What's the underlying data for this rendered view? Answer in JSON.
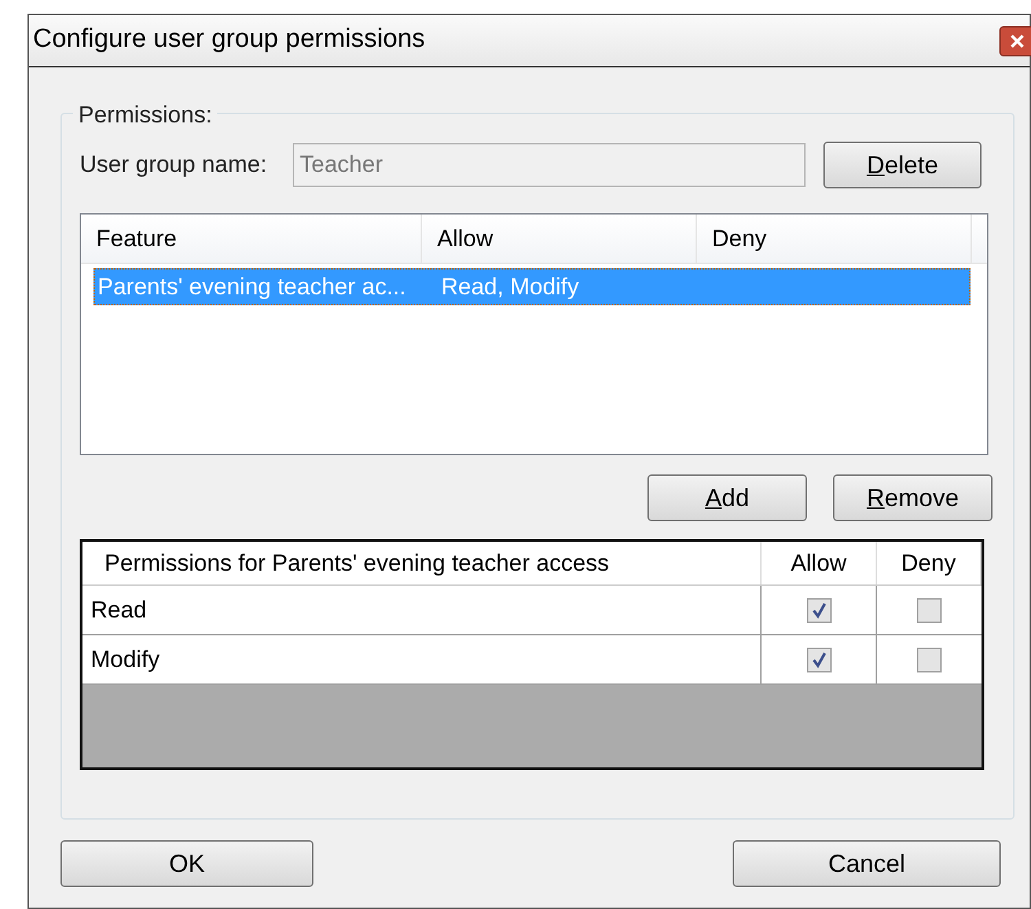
{
  "window": {
    "title": "Configure user group permissions"
  },
  "group": {
    "legend": "Permissions:",
    "name_label": "User group name:",
    "name_value": "Teacher",
    "name_disabled": true,
    "delete_button": {
      "label": "Delete",
      "underline_first": true
    }
  },
  "features": {
    "columns": [
      "Feature",
      "Allow",
      "Deny"
    ],
    "rows": [
      {
        "cells": [
          "Parents' evening teacher ac...",
          "Read, Modify",
          ""
        ],
        "selected": true
      }
    ]
  },
  "list_buttons": [
    {
      "label": "Add",
      "underline_first": true
    },
    {
      "label": "Remove",
      "underline_first": true
    }
  ],
  "permissions": {
    "columns": [
      "Permissions for Parents' evening teacher access",
      "Allow",
      "Deny"
    ],
    "rows": [
      {
        "name": "Read",
        "allow": true,
        "deny": false
      },
      {
        "name": "Modify",
        "allow": true,
        "deny": false
      }
    ]
  },
  "buttons": [
    {
      "label": "OK",
      "underline_first": false
    },
    {
      "label": "Cancel",
      "underline_first": false
    }
  ]
}
